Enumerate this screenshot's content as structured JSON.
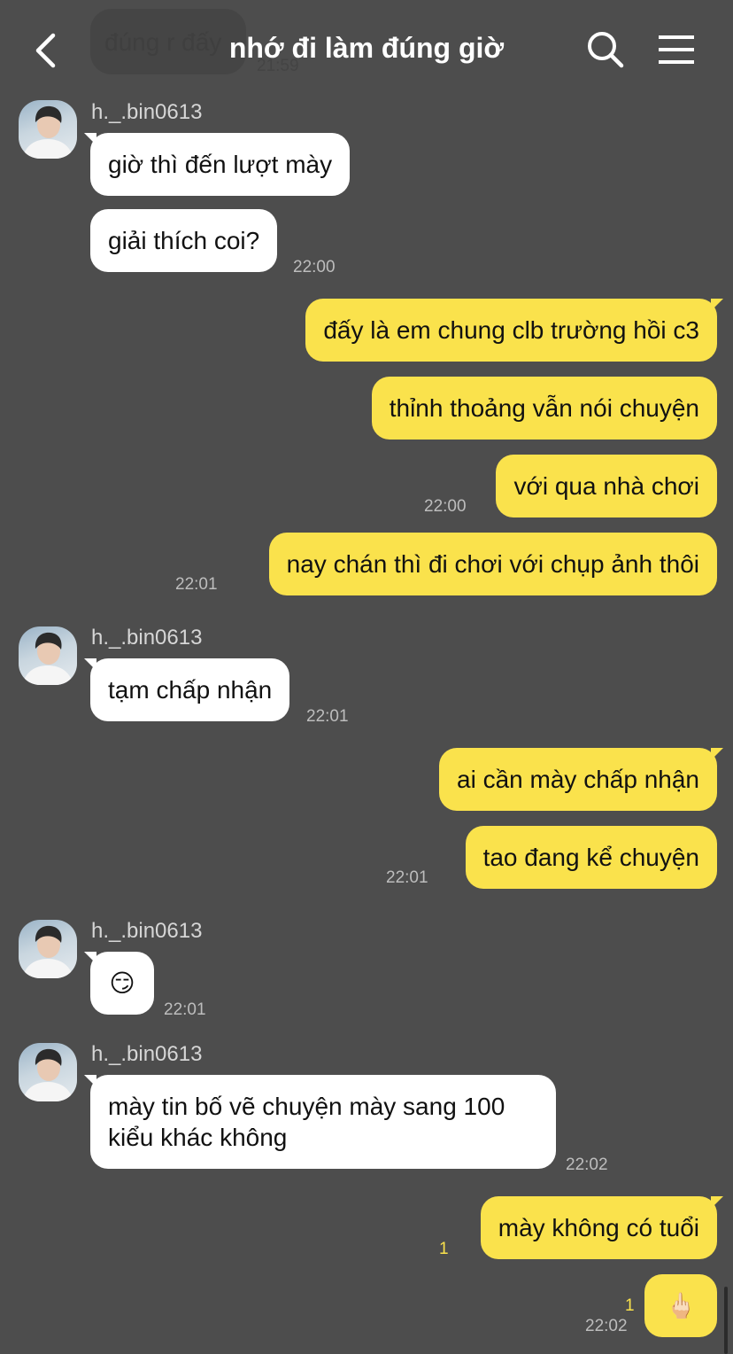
{
  "header": {
    "title": "nhớ đi làm đúng giờ",
    "back_icon": "chevron-left-icon",
    "search_icon": "search-icon",
    "menu_icon": "hamburger-menu-icon"
  },
  "ghost": {
    "text": "đúng r đấy",
    "time": "21:59"
  },
  "colors": {
    "background": "#4d4d4d",
    "outgoing_bubble": "#fae24c",
    "incoming_bubble": "#ffffff"
  },
  "messages": [
    {
      "sender": "h._.bin0613",
      "text": "giờ thì đến lượt mày"
    },
    {
      "text": "giải thích coi?",
      "time": "22:00"
    },
    {
      "text": "đấy là em chung clb trường hồi c3"
    },
    {
      "text": "thỉnh thoảng vẫn nói chuyện"
    },
    {
      "text": "với qua nhà chơi",
      "time": "22:00"
    },
    {
      "text": "nay chán thì đi chơi với chụp ảnh thôi",
      "time": "22:01"
    },
    {
      "sender": "h._.bin0613",
      "text": "tạm chấp nhận",
      "time": "22:01"
    },
    {
      "text": "ai cần mày chấp nhận"
    },
    {
      "text": "tao đang kể chuyện",
      "time": "22:01"
    },
    {
      "sender": "h._.bin0613",
      "text": "😏",
      "time": "22:01"
    },
    {
      "sender": "h._.bin0613",
      "line1": "mày tin bố vẽ chuyện mày sang 100",
      "line2": "kiểu khác không",
      "time": "22:02"
    },
    {
      "text": "mày không có tuổi",
      "unread": "1"
    },
    {
      "text": "🖕🏻",
      "unread": "1",
      "time": "22:02"
    }
  ]
}
